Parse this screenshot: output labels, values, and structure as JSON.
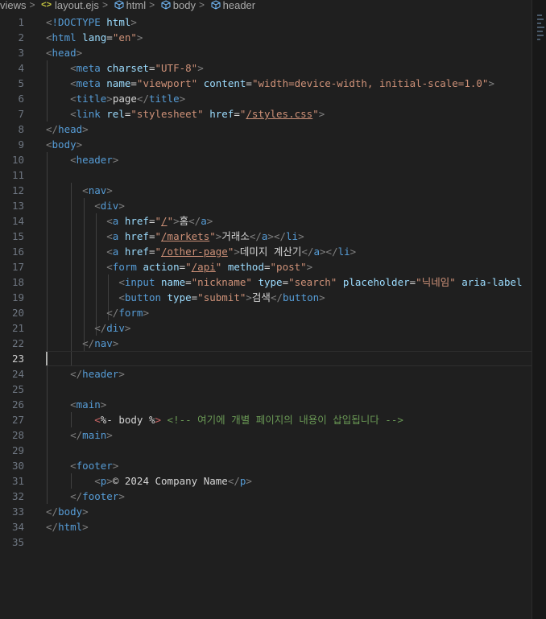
{
  "breadcrumb": {
    "folder": "views",
    "file": "layout.ejs",
    "file_icon": "<>",
    "items": [
      "html",
      "body",
      "header"
    ]
  },
  "editor": {
    "active_line": 23,
    "lines": [
      [
        [
          "bracket",
          "<"
        ],
        [
          "tag",
          "!DOCTYPE"
        ],
        [
          "text",
          " "
        ],
        [
          "attr",
          "html"
        ],
        [
          "bracket",
          ">"
        ]
      ],
      [
        [
          "bracket",
          "<"
        ],
        [
          "tag",
          "html"
        ],
        [
          "text",
          " "
        ],
        [
          "attr",
          "lang"
        ],
        [
          "text",
          "="
        ],
        [
          "str",
          "\"en\""
        ],
        [
          "bracket",
          ">"
        ]
      ],
      [
        [
          "bracket",
          "<"
        ],
        [
          "tag",
          "head"
        ],
        [
          "bracket",
          ">"
        ]
      ],
      [
        [
          "text",
          "    "
        ],
        [
          "bracket",
          "<"
        ],
        [
          "tag",
          "meta"
        ],
        [
          "text",
          " "
        ],
        [
          "attr",
          "charset"
        ],
        [
          "text",
          "="
        ],
        [
          "str",
          "\"UTF-8\""
        ],
        [
          "bracket",
          ">"
        ]
      ],
      [
        [
          "text",
          "    "
        ],
        [
          "bracket",
          "<"
        ],
        [
          "tag",
          "meta"
        ],
        [
          "text",
          " "
        ],
        [
          "attr",
          "name"
        ],
        [
          "text",
          "="
        ],
        [
          "str",
          "\"viewport\""
        ],
        [
          "text",
          " "
        ],
        [
          "attr",
          "content"
        ],
        [
          "text",
          "="
        ],
        [
          "str",
          "\"width=device-width, initial-scale=1.0\""
        ],
        [
          "bracket",
          ">"
        ]
      ],
      [
        [
          "text",
          "    "
        ],
        [
          "bracket",
          "<"
        ],
        [
          "tag",
          "title"
        ],
        [
          "bracket",
          ">"
        ],
        [
          "text",
          "page"
        ],
        [
          "bracket",
          "</"
        ],
        [
          "tag",
          "title"
        ],
        [
          "bracket",
          ">"
        ]
      ],
      [
        [
          "text",
          "    "
        ],
        [
          "bracket",
          "<"
        ],
        [
          "tag",
          "link"
        ],
        [
          "text",
          " "
        ],
        [
          "attr",
          "rel"
        ],
        [
          "text",
          "="
        ],
        [
          "str",
          "\"stylesheet\""
        ],
        [
          "text",
          " "
        ],
        [
          "attr",
          "href"
        ],
        [
          "text",
          "="
        ],
        [
          "str",
          "\""
        ],
        [
          "link",
          "/styles.css"
        ],
        [
          "str",
          "\""
        ],
        [
          "bracket",
          ">"
        ]
      ],
      [
        [
          "bracket",
          "</"
        ],
        [
          "tag",
          "head"
        ],
        [
          "bracket",
          ">"
        ]
      ],
      [
        [
          "bracket",
          "<"
        ],
        [
          "tag",
          "body"
        ],
        [
          "bracket",
          ">"
        ]
      ],
      [
        [
          "text",
          "    "
        ],
        [
          "bracket",
          "<"
        ],
        [
          "tag",
          "header"
        ],
        [
          "bracket",
          ">"
        ]
      ],
      [],
      [
        [
          "text",
          "      "
        ],
        [
          "bracket",
          "<"
        ],
        [
          "tag",
          "nav"
        ],
        [
          "bracket",
          ">"
        ]
      ],
      [
        [
          "text",
          "        "
        ],
        [
          "bracket",
          "<"
        ],
        [
          "tag",
          "div"
        ],
        [
          "bracket",
          ">"
        ]
      ],
      [
        [
          "text",
          "          "
        ],
        [
          "bracket",
          "<"
        ],
        [
          "tag",
          "a"
        ],
        [
          "text",
          " "
        ],
        [
          "attr",
          "href"
        ],
        [
          "text",
          "="
        ],
        [
          "str",
          "\""
        ],
        [
          "link",
          "/"
        ],
        [
          "str",
          "\""
        ],
        [
          "bracket",
          ">"
        ],
        [
          "text",
          "홈"
        ],
        [
          "bracket",
          "</"
        ],
        [
          "tag",
          "a"
        ],
        [
          "bracket",
          ">"
        ]
      ],
      [
        [
          "text",
          "          "
        ],
        [
          "bracket",
          "<"
        ],
        [
          "tag",
          "a"
        ],
        [
          "text",
          " "
        ],
        [
          "attr",
          "href"
        ],
        [
          "text",
          "="
        ],
        [
          "str",
          "\""
        ],
        [
          "link",
          "/markets"
        ],
        [
          "str",
          "\""
        ],
        [
          "bracket",
          ">"
        ],
        [
          "text",
          "거래소"
        ],
        [
          "bracket",
          "</"
        ],
        [
          "tag",
          "a"
        ],
        [
          "bracket",
          "></"
        ],
        [
          "tag",
          "li"
        ],
        [
          "bracket",
          ">"
        ]
      ],
      [
        [
          "text",
          "          "
        ],
        [
          "bracket",
          "<"
        ],
        [
          "tag",
          "a"
        ],
        [
          "text",
          " "
        ],
        [
          "attr",
          "href"
        ],
        [
          "text",
          "="
        ],
        [
          "str",
          "\""
        ],
        [
          "link",
          "/other-page"
        ],
        [
          "str",
          "\""
        ],
        [
          "bracket",
          ">"
        ],
        [
          "text",
          "데미지 계산기"
        ],
        [
          "bracket",
          "</"
        ],
        [
          "tag",
          "a"
        ],
        [
          "bracket",
          "></"
        ],
        [
          "tag",
          "li"
        ],
        [
          "bracket",
          ">"
        ]
      ],
      [
        [
          "text",
          "          "
        ],
        [
          "bracket",
          "<"
        ],
        [
          "tag",
          "form"
        ],
        [
          "text",
          " "
        ],
        [
          "attr",
          "action"
        ],
        [
          "text",
          "="
        ],
        [
          "str",
          "\""
        ],
        [
          "link",
          "/api"
        ],
        [
          "str",
          "\""
        ],
        [
          "text",
          " "
        ],
        [
          "attr",
          "method"
        ],
        [
          "text",
          "="
        ],
        [
          "str",
          "\"post\""
        ],
        [
          "bracket",
          ">"
        ]
      ],
      [
        [
          "text",
          "            "
        ],
        [
          "bracket",
          "<"
        ],
        [
          "tag",
          "input"
        ],
        [
          "text",
          " "
        ],
        [
          "attr",
          "name"
        ],
        [
          "text",
          "="
        ],
        [
          "str",
          "\"nickname\""
        ],
        [
          "text",
          " "
        ],
        [
          "attr",
          "type"
        ],
        [
          "text",
          "="
        ],
        [
          "str",
          "\"search\""
        ],
        [
          "text",
          " "
        ],
        [
          "attr",
          "placeholder"
        ],
        [
          "text",
          "="
        ],
        [
          "str",
          "\"닉네임\""
        ],
        [
          "text",
          " "
        ],
        [
          "attr",
          "aria-label"
        ]
      ],
      [
        [
          "text",
          "            "
        ],
        [
          "bracket",
          "<"
        ],
        [
          "tag",
          "button"
        ],
        [
          "text",
          " "
        ],
        [
          "attr",
          "type"
        ],
        [
          "text",
          "="
        ],
        [
          "str",
          "\"submit\""
        ],
        [
          "bracket",
          ">"
        ],
        [
          "text",
          "검색"
        ],
        [
          "bracket",
          "</"
        ],
        [
          "tag",
          "button"
        ],
        [
          "bracket",
          ">"
        ]
      ],
      [
        [
          "text",
          "          "
        ],
        [
          "bracket",
          "</"
        ],
        [
          "tag",
          "form"
        ],
        [
          "bracket",
          ">"
        ]
      ],
      [
        [
          "text",
          "        "
        ],
        [
          "bracket",
          "</"
        ],
        [
          "tag",
          "div"
        ],
        [
          "bracket",
          ">"
        ]
      ],
      [
        [
          "text",
          "      "
        ],
        [
          "bracket",
          "</"
        ],
        [
          "tag",
          "nav"
        ],
        [
          "bracket",
          ">"
        ]
      ],
      [],
      [
        [
          "text",
          "    "
        ],
        [
          "bracket",
          "</"
        ],
        [
          "tag",
          "header"
        ],
        [
          "bracket",
          ">"
        ]
      ],
      [],
      [
        [
          "text",
          "    "
        ],
        [
          "bracket",
          "<"
        ],
        [
          "tag",
          "main"
        ],
        [
          "bracket",
          ">"
        ]
      ],
      [
        [
          "text",
          "        "
        ],
        [
          "ejs",
          "<"
        ],
        [
          "text",
          "%- body %"
        ],
        [
          "ejs",
          ">"
        ],
        [
          "text",
          " "
        ],
        [
          "comment",
          "<!-- 여기에 개별 페이지의 내용이 삽입됩니다 -->"
        ]
      ],
      [
        [
          "text",
          "    "
        ],
        [
          "bracket",
          "</"
        ],
        [
          "tag",
          "main"
        ],
        [
          "bracket",
          ">"
        ]
      ],
      [],
      [
        [
          "text",
          "    "
        ],
        [
          "bracket",
          "<"
        ],
        [
          "tag",
          "footer"
        ],
        [
          "bracket",
          ">"
        ]
      ],
      [
        [
          "text",
          "        "
        ],
        [
          "bracket",
          "<"
        ],
        [
          "tag",
          "p"
        ],
        [
          "bracket",
          ">"
        ],
        [
          "text",
          "© 2024 Company Name"
        ],
        [
          "bracket",
          "</"
        ],
        [
          "tag",
          "p"
        ],
        [
          "bracket",
          ">"
        ]
      ],
      [
        [
          "text",
          "    "
        ],
        [
          "bracket",
          "</"
        ],
        [
          "tag",
          "footer"
        ],
        [
          "bracket",
          ">"
        ]
      ],
      [
        [
          "bracket",
          "</"
        ],
        [
          "tag",
          "body"
        ],
        [
          "bracket",
          ">"
        ]
      ],
      [
        [
          "bracket",
          "</"
        ],
        [
          "tag",
          "html"
        ],
        [
          "bracket",
          ">"
        ]
      ],
      []
    ]
  }
}
